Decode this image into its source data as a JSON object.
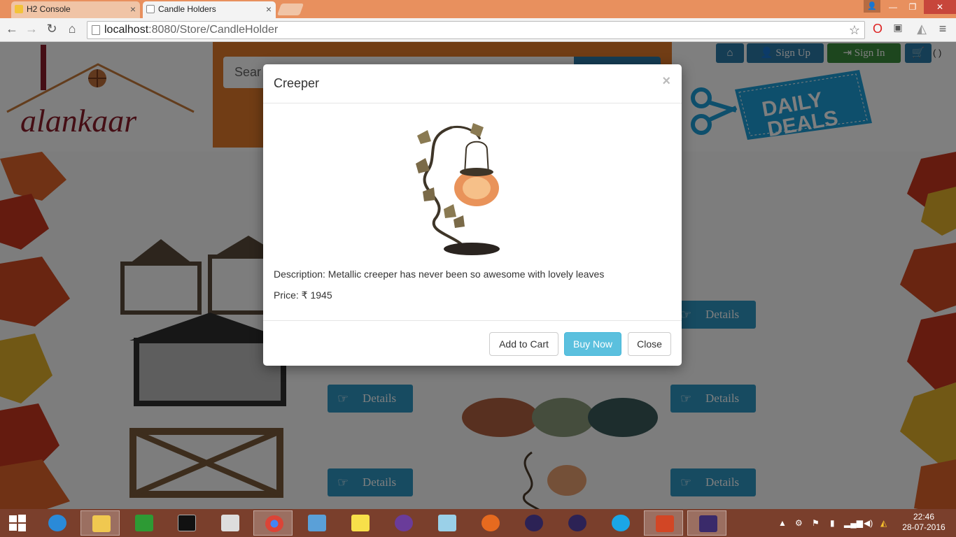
{
  "browser": {
    "tabs": [
      {
        "title": "H2 Console",
        "active": false
      },
      {
        "title": "Candle Holders",
        "active": true
      }
    ],
    "url_host": "localhost",
    "url_path": ":8080/Store/CandleHolder"
  },
  "site": {
    "logo_text": "alankaar",
    "search_placeholder": "Sear",
    "nav": {
      "home_label": "",
      "signup_label": "Sign   Up",
      "signin_label": "Sign   In",
      "cart_count": "( )"
    },
    "deals_text_1": "DAILY",
    "deals_text_2": "DEALS",
    "details_label": "Details",
    "colors": {
      "banner_orange": "#e27a2a",
      "nav_blue": "#2a7aa8",
      "signin_green": "#3a8c3c",
      "details_blue": "#2e97c3",
      "buy_info": "#5bc0de"
    }
  },
  "modal": {
    "title": "Creeper",
    "close_glyph": "×",
    "description": "Description: Metallic creeper has never been so awesome with lovely leaves",
    "price": "Price: ₹ 1945",
    "buttons": {
      "add_to_cart": "Add to Cart",
      "buy_now": "Buy Now",
      "close": "Close"
    }
  },
  "taskbar": {
    "time": "22:46",
    "date": "28-07-2016"
  }
}
